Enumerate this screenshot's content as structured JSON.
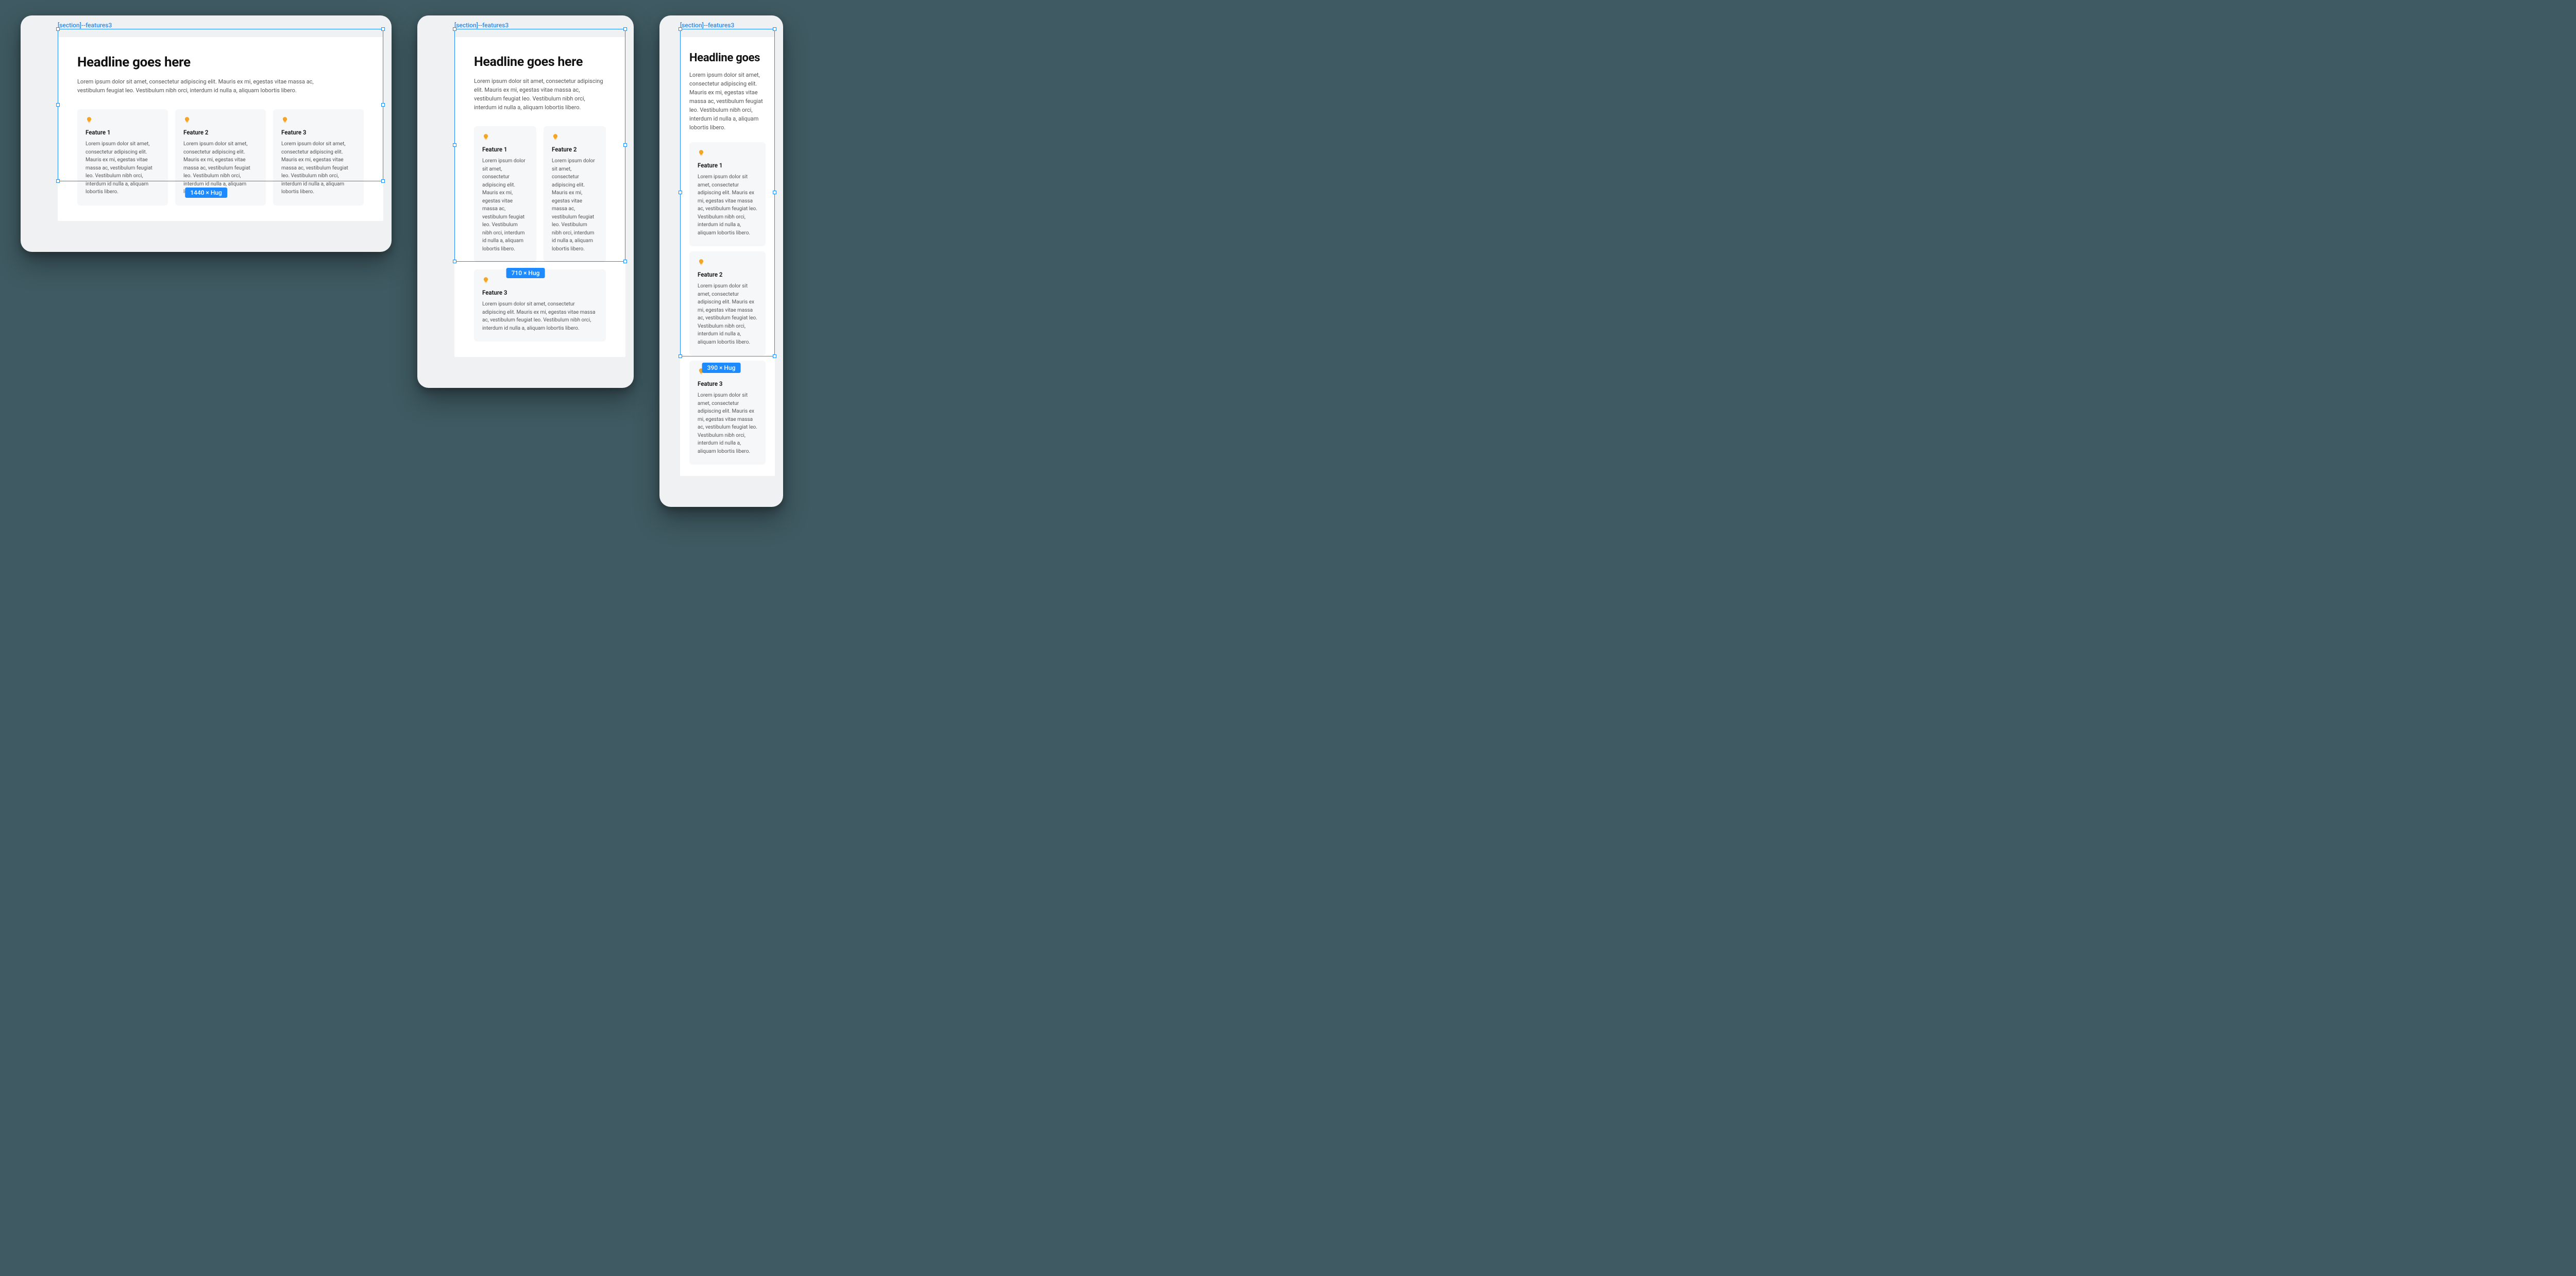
{
  "frame_label": "[section]--features3",
  "badges": {
    "desktop": "1440 × Hug",
    "tablet": "710 × Hug",
    "mobile": "390 × Hug"
  },
  "section": {
    "headline_full": "Headline goes here",
    "headline_short": "Headline goes",
    "subhead": "Lorem ipsum dolor sit amet, consectetur adipiscing elit. Mauris ex mi, egestas vitae massa ac, vestibulum feugiat leo. Vestibulum nibh orci, interdum id nulla a, aliquam lobortis libero.",
    "features": [
      {
        "title": "Feature 1",
        "body": "Lorem ipsum dolor sit amet, consectetur adipiscing elit. Mauris ex mi, egestas vitae massa ac, vestibulum feugiat leo. Vestibulum nibh orci, interdum id nulla a, aliquam lobortis libero."
      },
      {
        "title": "Feature 2",
        "body": "Lorem ipsum dolor sit amet, consectetur adipiscing elit. Mauris ex mi, egestas vitae massa ac, vestibulum feugiat leo. Vestibulum nibh orci, interdum id nulla a, aliquam lobortis libero."
      },
      {
        "title": "Feature 3",
        "body": "Lorem ipsum dolor sit amet, consectetur adipiscing elit. Mauris ex mi, egestas vitae massa ac, vestibulum feugiat leo. Vestibulum nibh orci, interdum id nulla a, aliquam lobortis libero."
      }
    ]
  }
}
